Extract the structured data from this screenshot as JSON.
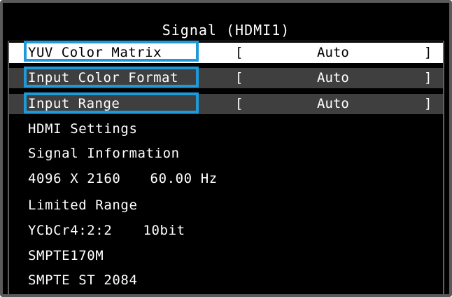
{
  "window": {
    "title": "Signal (HDMI1)"
  },
  "settings": [
    {
      "label": "YUV Color Matrix",
      "bracket_left": "[",
      "value": "Auto",
      "bracket_right": "]",
      "state": "selected"
    },
    {
      "label": "Input Color Format",
      "bracket_left": "[",
      "value": "Auto",
      "bracket_right": "]",
      "state": "normal"
    },
    {
      "label": "Input Range",
      "bracket_left": "[",
      "value": "Auto",
      "bracket_right": "]",
      "state": "normal"
    }
  ],
  "info": {
    "hdmi_settings": "HDMI Settings",
    "signal_information": "Signal Information",
    "resolution": "4096 X 2160",
    "refresh_rate": "60.00 Hz",
    "range": "Limited Range",
    "color_format": "YCbCr4:2:2",
    "bit_depth": "10bit",
    "color_standard": "SMPTE170M",
    "transfer_standard": "SMPTE ST 2084"
  },
  "colors": {
    "background": "#000000",
    "selected_row": "#ffffff",
    "dim_row": "#3f3f3f",
    "highlight_outline": "#1e9ad8",
    "text": "#ffffff"
  }
}
